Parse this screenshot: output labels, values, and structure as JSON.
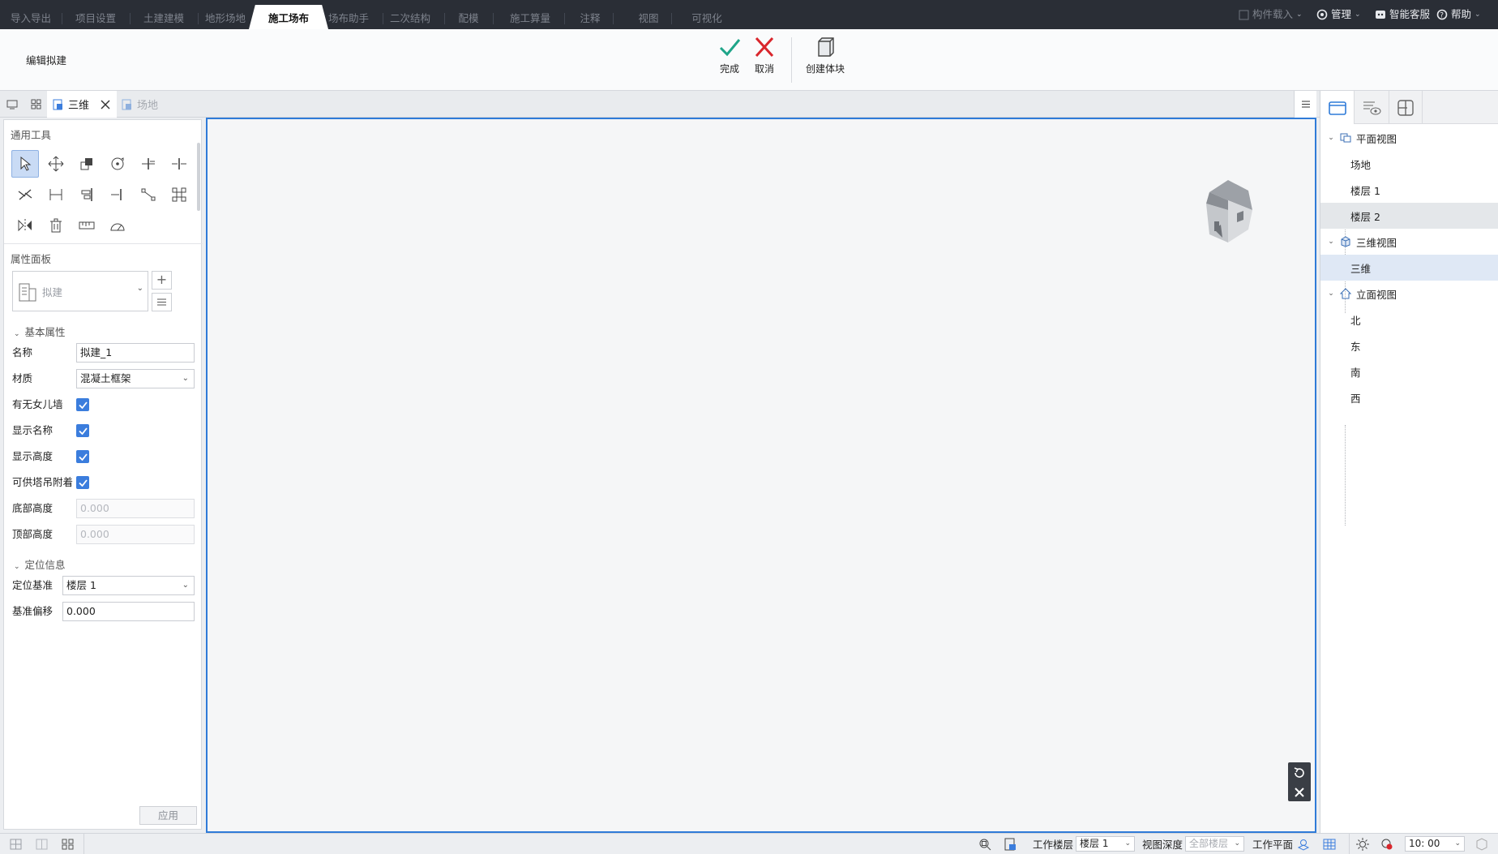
{
  "menu_tabs": [
    "导入导出",
    "项目设置",
    "土建建模",
    "地形场地",
    "施工场布",
    "场布助手",
    "二次结构",
    "配模",
    "施工算量",
    "注释",
    "视图",
    "可视化"
  ],
  "active_tab": "施工场布",
  "top_right": {
    "load_component": "构件载入",
    "manage": "管理",
    "service": "智能客服",
    "help": "帮助"
  },
  "ribbon": {
    "title": "编辑拟建",
    "finish": "完成",
    "cancel": "取消",
    "create_block": "创建体块"
  },
  "view_tabs": {
    "three_d": "三维",
    "site": "场地"
  },
  "left_panel": {
    "general_tools_title": "通用工具",
    "props_title": "属性面板",
    "type_placeholder": "拟建",
    "basic_group": "基本属性",
    "name_label": "名称",
    "name_value": "拟建_1",
    "material_label": "材质",
    "material_value": "混凝土框架",
    "parapet_label": "有无女儿墙",
    "show_name_label": "显示名称",
    "show_height_label": "显示高度",
    "crane_label": "可供塔吊附着",
    "bottom_label": "底部高度",
    "bottom_value": "0.000",
    "top_label": "顶部高度",
    "top_value": "0.000",
    "position_group": "定位信息",
    "ref_label": "定位基准",
    "ref_value": "楼层 1",
    "offset_label": "基准偏移",
    "offset_value": "0.000",
    "apply": "应用"
  },
  "right_panel": {
    "plan_view": "平面视图",
    "plan_items": [
      "场地",
      "楼层 1",
      "楼层 2"
    ],
    "three_d_view": "三维视图",
    "three_d_items": [
      "三维"
    ],
    "elevation_view": "立面视图",
    "elevation_items": [
      "北",
      "东",
      "南",
      "西"
    ]
  },
  "status_bar": {
    "work_floor_label": "工作楼层",
    "work_floor_value": "楼层 1",
    "view_depth_label": "视图深度",
    "view_depth_value": "全部楼层",
    "work_plane_label": "工作平面",
    "time_value": "10: 00"
  },
  "colors": {
    "accent": "#2f7bd8",
    "topbar": "#2a2e36",
    "finish_green": "#1fa589",
    "cancel_red": "#d9262c"
  }
}
